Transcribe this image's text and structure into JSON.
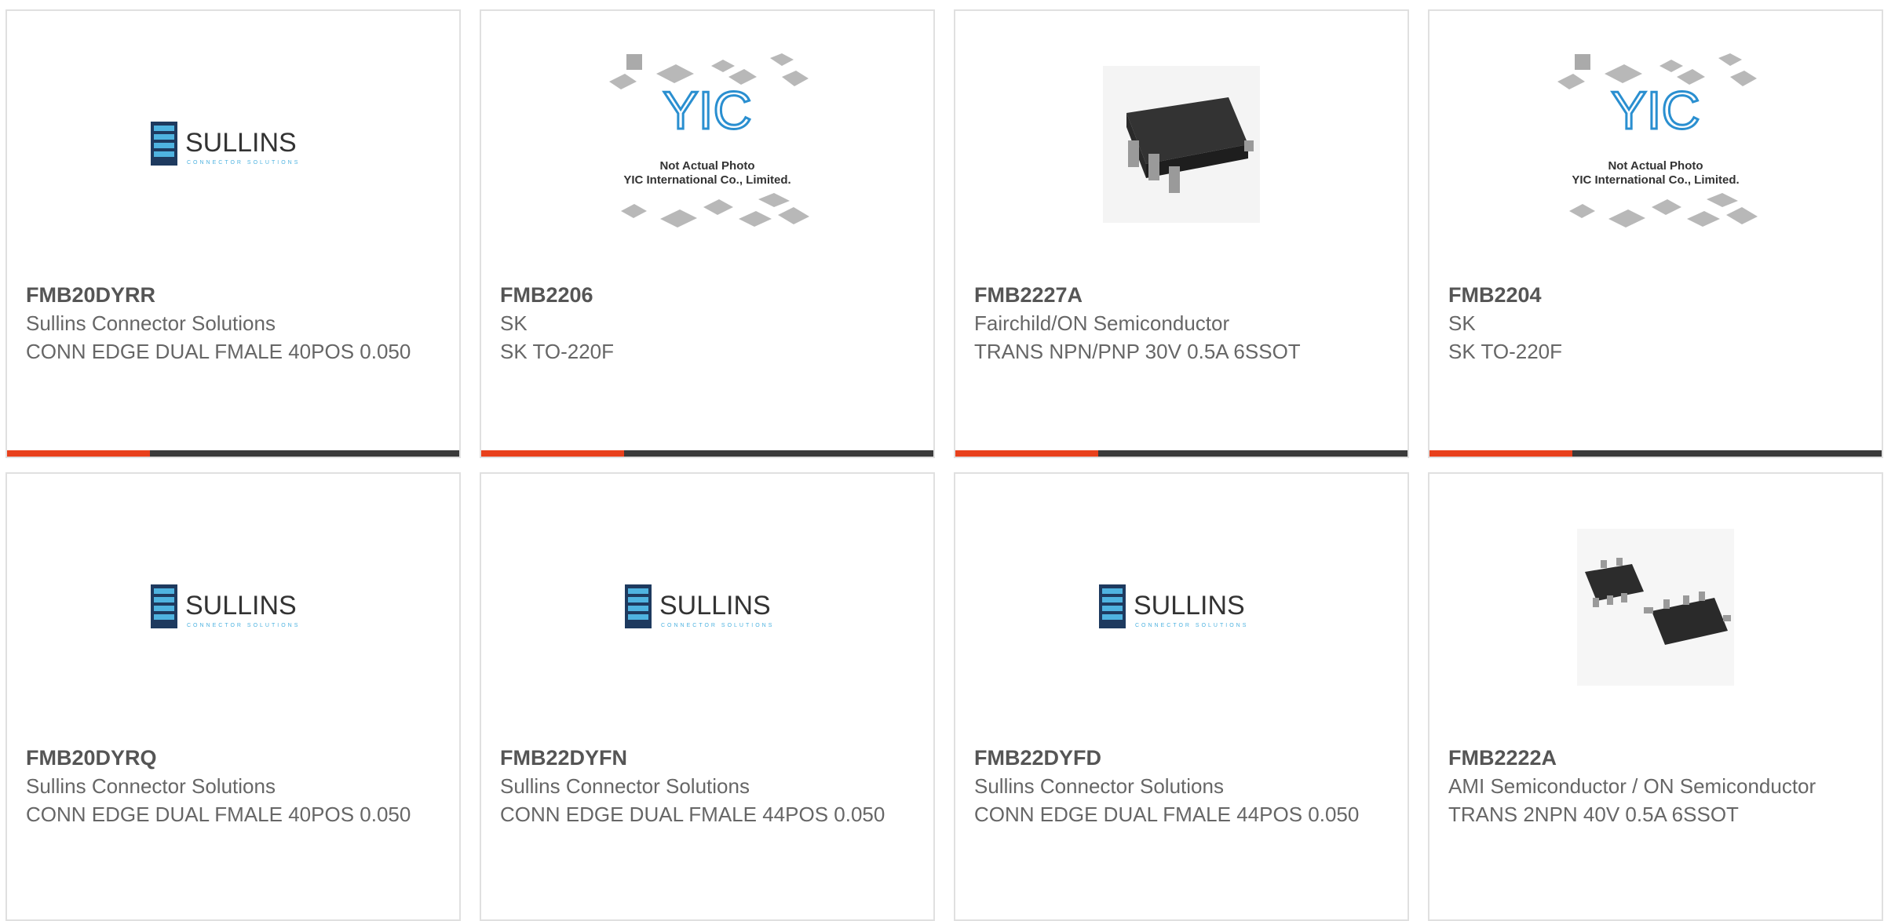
{
  "colors": {
    "accent": "#e8401c",
    "bar": "#3a3a3a",
    "border": "#e0e0e0",
    "text": "#666666"
  },
  "products": [
    {
      "part": "FMB20DYRR",
      "maker": "Sullins Connector Solutions",
      "desc": "CONN EDGE DUAL FMALE 40POS 0.050",
      "image": "sullins-logo"
    },
    {
      "part": "FMB2206",
      "maker": "SK",
      "desc": "SK TO-220F",
      "image": "yic-placeholder"
    },
    {
      "part": "FMB2227A",
      "maker": "Fairchild/ON Semiconductor",
      "desc": "TRANS NPN/PNP 30V 0.5A 6SSOT",
      "image": "chip-photo"
    },
    {
      "part": "FMB2204",
      "maker": "SK",
      "desc": "SK TO-220F",
      "image": "yic-placeholder"
    },
    {
      "part": "FMB20DYRQ",
      "maker": "Sullins Connector Solutions",
      "desc": "CONN EDGE DUAL FMALE 40POS 0.050",
      "image": "sullins-logo"
    },
    {
      "part": "FMB22DYFN",
      "maker": "Sullins Connector Solutions",
      "desc": "CONN EDGE DUAL FMALE 44POS 0.050",
      "image": "sullins-logo"
    },
    {
      "part": "FMB22DYFD",
      "maker": "Sullins Connector Solutions",
      "desc": "CONN EDGE DUAL FMALE 44POS 0.050",
      "image": "sullins-logo"
    },
    {
      "part": "FMB2222A",
      "maker": "AMI Semiconductor / ON Semiconductor",
      "desc": "TRANS 2NPN 40V 0.5A 6SSOT",
      "image": "chip-photo-2"
    }
  ],
  "logos": {
    "sullins_name": "SULLINS",
    "sullins_tagline": "CONNECTOR SOLUTIONS",
    "yic_brand": "YIC",
    "yic_line1": "Not Actual Photo",
    "yic_line2": "YIC International Co., Limited."
  }
}
